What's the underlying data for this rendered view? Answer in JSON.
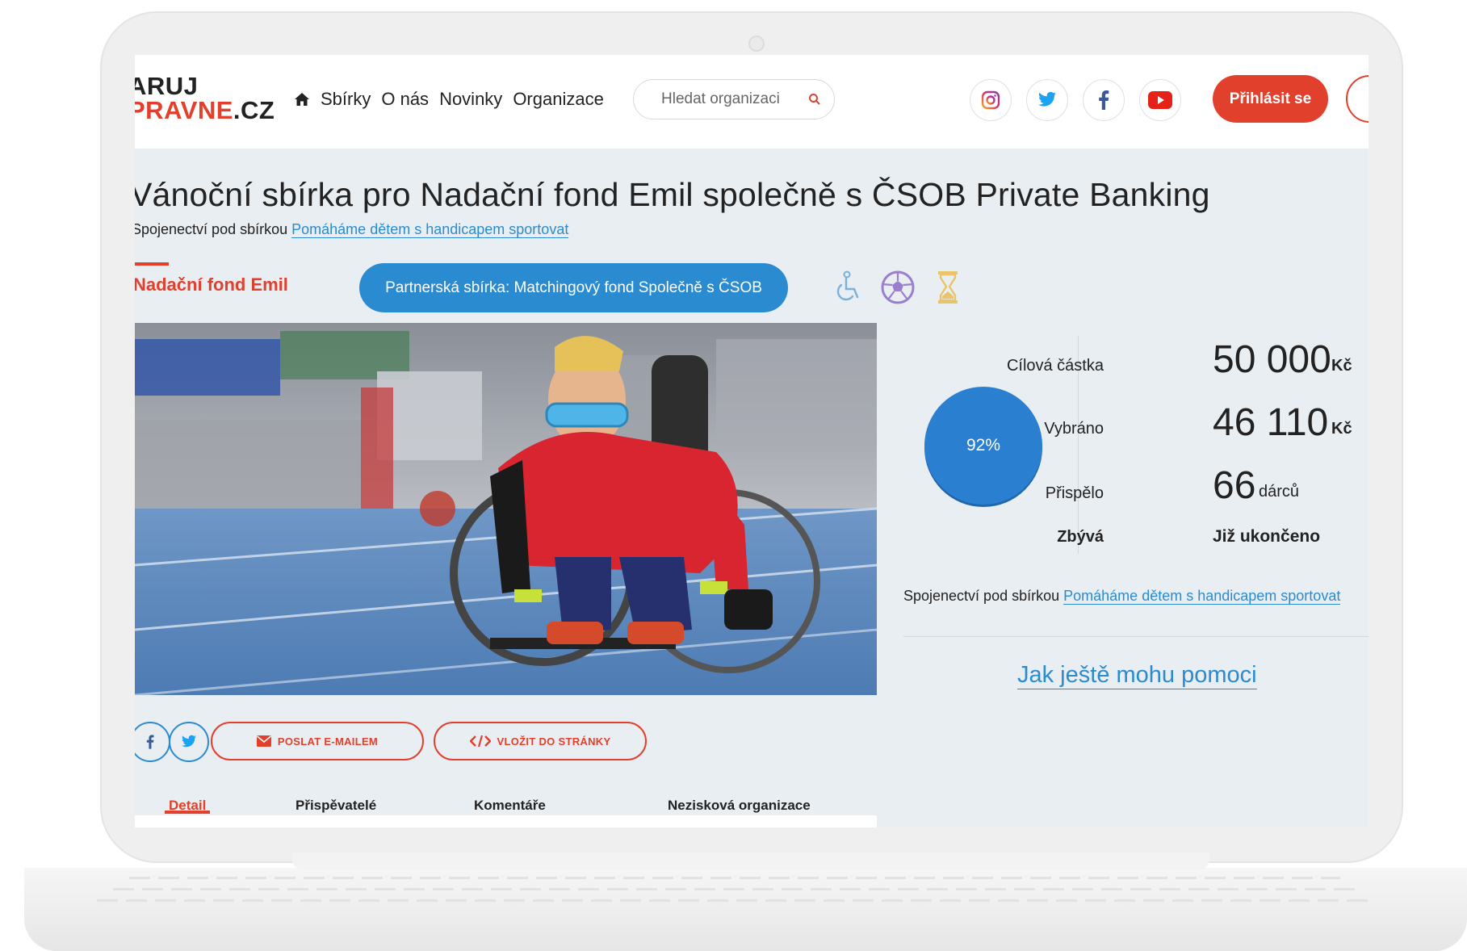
{
  "header": {
    "logo_line1": "ARUJ",
    "logo_line2_red": "PRAVNE",
    "logo_line2_dark": ".CZ",
    "nav": [
      "Sbírky",
      "O nás",
      "Novinky",
      "Organizace"
    ],
    "search_placeholder": "Hledat organizaci",
    "social": [
      "instagram-icon",
      "twitter-icon",
      "facebook-icon",
      "youtube-icon"
    ],
    "login_label": "Přihlásit se"
  },
  "campaign": {
    "title": "Vánoční sbírka pro Nadační fond Emil společně s ČSOB Private Banking",
    "alliance_prefix": "Spojenectví pod sbírkou",
    "alliance_link": "Pomáháme dětem s handicapem sportovat",
    "organization": "Nadační fond Emil",
    "partner_label": "Partnerská sbírka: Matchingový fond Společně s ČSOB",
    "category_icons": [
      "wheelchair-icon",
      "ball-icon",
      "hourglass-icon"
    ]
  },
  "share": {
    "email_label": "POSLAT E-MAILEM",
    "embed_label": "VLOŽIT DO STRÁNKY"
  },
  "tabs": [
    "Detail",
    "Přispěvatelé",
    "Komentáře",
    "Nezisková organizace"
  ],
  "active_tab": "Detail",
  "stats": {
    "progress_label": "92%",
    "progress_fraction": 0.92,
    "target_label": "Cílová částka",
    "target_value": "50 000",
    "target_unit": "Kč",
    "collected_label": "Vybráno",
    "collected_value": "46 110",
    "collected_unit": "Kč",
    "donors_label": "Přispělo",
    "donors_value": "66",
    "donors_unit": "dárců",
    "remaining_label": "Zbývá",
    "remaining_value": "Již ukončeno"
  },
  "sidebar": {
    "alliance_prefix": "Spojenectví pod sbírkou",
    "alliance_link": "Pomáháme dětem s handicapem sportovat",
    "help_link": "Jak ještě mohu pomoci"
  },
  "colors": {
    "accent_red": "#e1402c",
    "accent_blue": "#2a8bd0",
    "page_bg": "#e9eef2"
  }
}
